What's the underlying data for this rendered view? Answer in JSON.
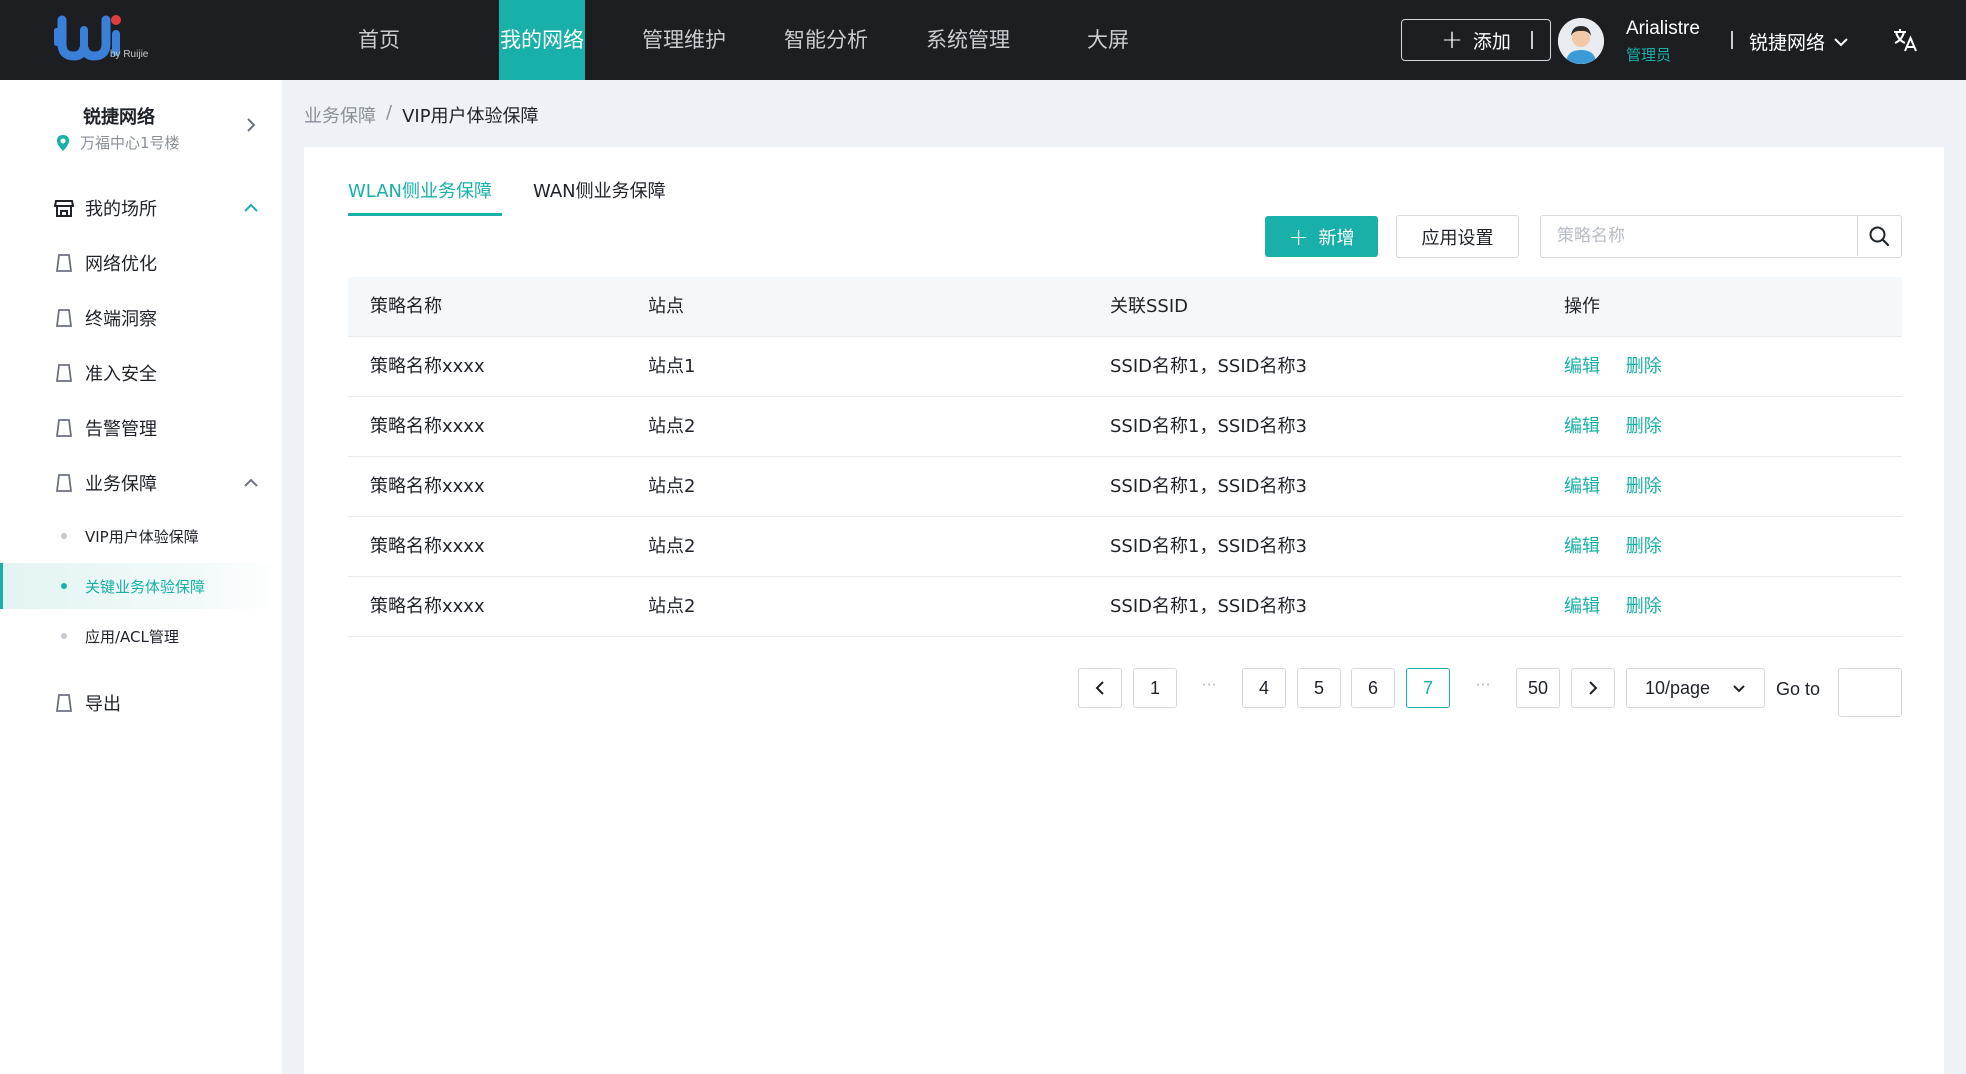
{
  "header": {
    "logo_sub": "by Ruijie",
    "nav": [
      {
        "label": "首页"
      },
      {
        "label": "我的网络"
      },
      {
        "label": "管理维护"
      },
      {
        "label": "智能分析"
      },
      {
        "label": "系统管理"
      },
      {
        "label": "大屏"
      }
    ],
    "add_label": "添加",
    "user_name": "Arialistre",
    "user_role": "管理员",
    "org_label": "锐捷网络"
  },
  "sidebar": {
    "site_name": "锐捷网络",
    "site_location": "万福中心1号楼",
    "menu": [
      {
        "label": "我的场所"
      },
      {
        "label": "网络优化"
      },
      {
        "label": "终端洞察"
      },
      {
        "label": "准入安全"
      },
      {
        "label": "告警管理"
      },
      {
        "label": "业务保障"
      },
      {
        "label": "导出"
      }
    ],
    "sub_items": [
      {
        "label": "VIP用户体验保障"
      },
      {
        "label": "关键业务体验保障"
      },
      {
        "label": "应用/ACL管理"
      }
    ]
  },
  "breadcrumb": {
    "parent": "业务保障",
    "separator": "/",
    "current": "VIP用户体验保障"
  },
  "tabs": [
    {
      "label": "WLAN侧业务保障"
    },
    {
      "label": "WAN侧业务保障"
    }
  ],
  "toolbar": {
    "new_label": "新增",
    "settings_label": "应用设置",
    "search_placeholder": "策略名称"
  },
  "table": {
    "columns": [
      "策略名称",
      "站点",
      "关联SSID",
      "操作"
    ],
    "rows": [
      {
        "name": "策略名称xxxx",
        "site": "站点1",
        "ssid": "SSID名称1，SSID名称3"
      },
      {
        "name": "策略名称xxxx",
        "site": "站点2",
        "ssid": "SSID名称1，SSID名称3"
      },
      {
        "name": "策略名称xxxx",
        "site": "站点2",
        "ssid": "SSID名称1，SSID名称3"
      },
      {
        "name": "策略名称xxxx",
        "site": "站点2",
        "ssid": "SSID名称1，SSID名称3"
      },
      {
        "name": "策略名称xxxx",
        "site": "站点2",
        "ssid": "SSID名称1，SSID名称3"
      }
    ],
    "edit_label": "编辑",
    "delete_label": "删除"
  },
  "pagination": {
    "pages": [
      "1",
      "4",
      "5",
      "6",
      "7",
      "50"
    ],
    "ellipsis": "···",
    "current": "7",
    "page_size": "10/page",
    "goto_label": "Go to"
  },
  "colors": {
    "accent": "#18b0a9",
    "topbar": "#1c1e21"
  }
}
